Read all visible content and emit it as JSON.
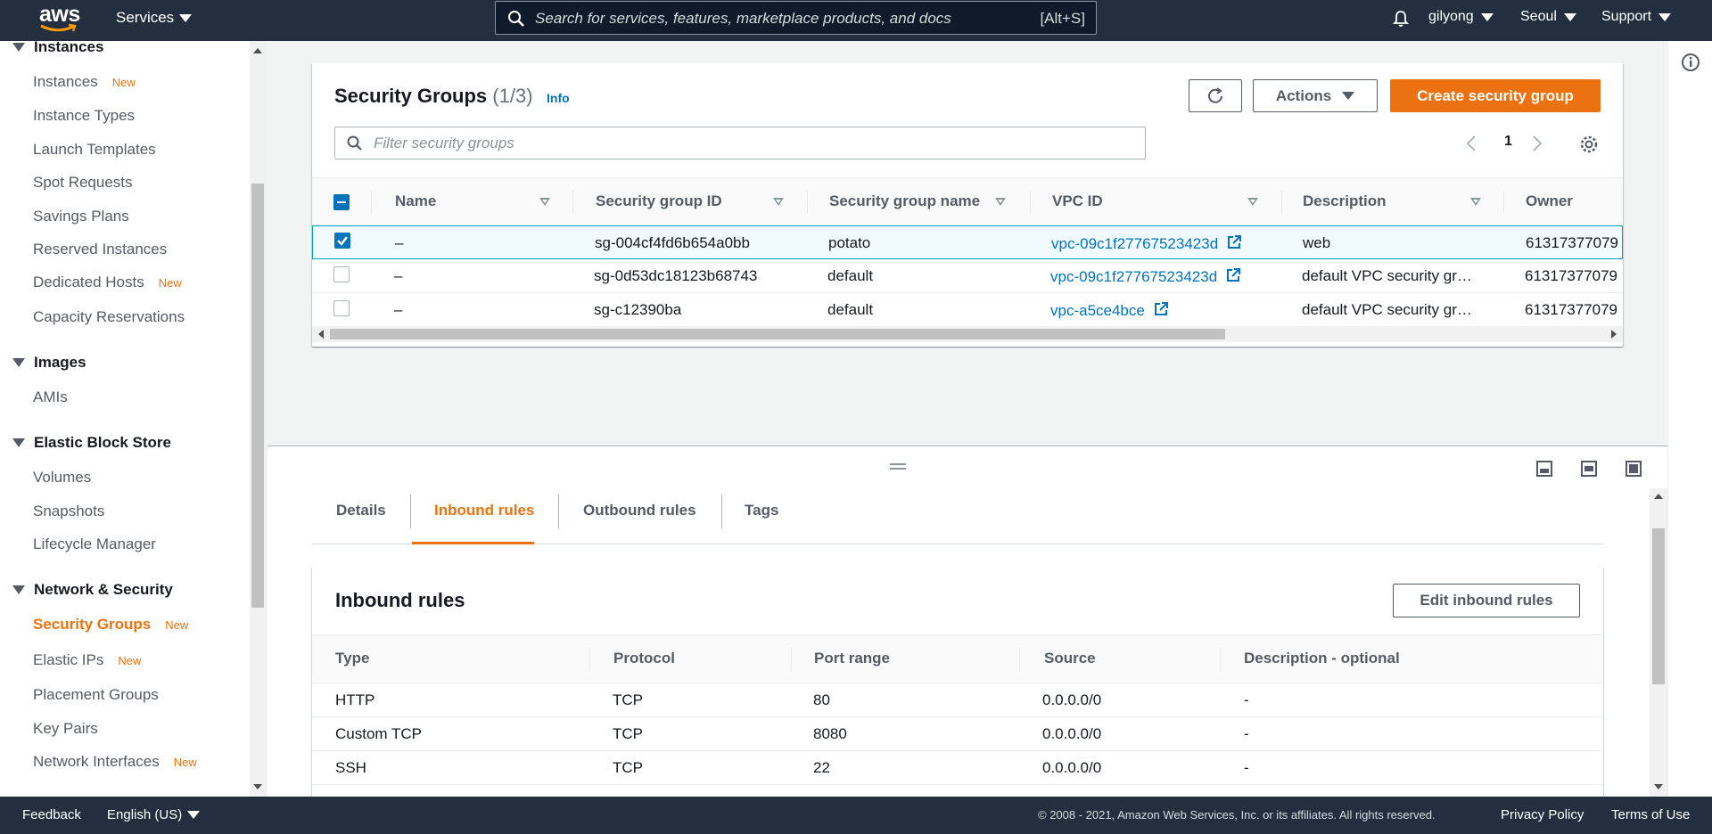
{
  "topnav": {
    "logo": "aws",
    "services_label": "Services",
    "search_placeholder": "Search for services, features, marketplace products, and docs",
    "search_shortcut": "[Alt+S]",
    "user": "gilyong",
    "region": "Seoul",
    "support": "Support"
  },
  "sidebar": {
    "sections": [
      {
        "title": "Instances",
        "items": [
          {
            "label": "Instances",
            "badge": "New"
          },
          {
            "label": "Instance Types",
            "badge": ""
          },
          {
            "label": "Launch Templates",
            "badge": ""
          },
          {
            "label": "Spot Requests",
            "badge": ""
          },
          {
            "label": "Savings Plans",
            "badge": ""
          },
          {
            "label": "Reserved Instances",
            "badge": ""
          },
          {
            "label": "Dedicated Hosts",
            "badge": "New"
          },
          {
            "label": "Capacity Reservations",
            "badge": ""
          }
        ]
      },
      {
        "title": "Images",
        "items": [
          {
            "label": "AMIs",
            "badge": ""
          }
        ]
      },
      {
        "title": "Elastic Block Store",
        "items": [
          {
            "label": "Volumes",
            "badge": ""
          },
          {
            "label": "Snapshots",
            "badge": ""
          },
          {
            "label": "Lifecycle Manager",
            "badge": ""
          }
        ]
      },
      {
        "title": "Network & Security",
        "items": [
          {
            "label": "Security Groups",
            "badge": "New"
          },
          {
            "label": "Elastic IPs",
            "badge": "New"
          },
          {
            "label": "Placement Groups",
            "badge": ""
          },
          {
            "label": "Key Pairs",
            "badge": ""
          },
          {
            "label": "Network Interfaces",
            "badge": "New"
          }
        ]
      }
    ]
  },
  "security_groups": {
    "title": "Security Groups",
    "count": "(1/3)",
    "info": "Info",
    "actions_label": "Actions",
    "create_label": "Create security group",
    "filter_placeholder": "Filter security groups",
    "page": "1",
    "columns": [
      "Name",
      "Security group ID",
      "Security group name",
      "VPC ID",
      "Description",
      "Owner"
    ],
    "rows": [
      {
        "selected": true,
        "name": "–",
        "id": "sg-004cf4fd6b654a0bb",
        "group_name": "potato",
        "vpc": "vpc-09c1f27767523423d",
        "description": "web",
        "owner": "61317377079"
      },
      {
        "selected": false,
        "name": "–",
        "id": "sg-0d53dc18123b68743",
        "group_name": "default",
        "vpc": "vpc-09c1f27767523423d",
        "description": "default VPC security gr…",
        "owner": "61317377079"
      },
      {
        "selected": false,
        "name": "–",
        "id": "sg-c12390ba",
        "group_name": "default",
        "vpc": "vpc-a5ce4bce",
        "description": "default VPC security gr…",
        "owner": "61317377079"
      }
    ]
  },
  "details": {
    "tabs": [
      "Details",
      "Inbound rules",
      "Outbound rules",
      "Tags"
    ],
    "active_tab": "Inbound rules",
    "inbound": {
      "title": "Inbound rules",
      "edit_label": "Edit inbound rules",
      "columns": [
        "Type",
        "Protocol",
        "Port range",
        "Source",
        "Description - optional"
      ],
      "rows": [
        {
          "type": "HTTP",
          "protocol": "TCP",
          "port": "80",
          "source": "0.0.0.0/0",
          "desc": "-"
        },
        {
          "type": "Custom TCP",
          "protocol": "TCP",
          "port": "8080",
          "source": "0.0.0.0/0",
          "desc": "-"
        },
        {
          "type": "SSH",
          "protocol": "TCP",
          "port": "22",
          "source": "0.0.0.0/0",
          "desc": "-"
        }
      ]
    }
  },
  "footer": {
    "feedback": "Feedback",
    "language": "English (US)",
    "copyright": "© 2008 - 2021, Amazon Web Services, Inc. or its affiliates. All rights reserved.",
    "privacy": "Privacy Policy",
    "terms": "Terms of Use"
  },
  "colors": {
    "accent": "#ec7211",
    "link": "#0073bb",
    "nav_bg": "#232f3e"
  }
}
